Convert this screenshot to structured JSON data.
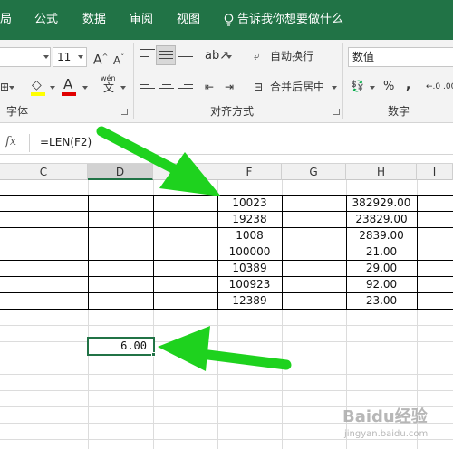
{
  "menu": {
    "tabs": [
      "局",
      "公式",
      "数据",
      "审阅",
      "视图"
    ],
    "tellme": "告诉我你想要做什么"
  },
  "ribbon": {
    "font_size": "11",
    "wen_glyph": "wén",
    "wen_char": "文",
    "wrap_text": "自动换行",
    "merge_center": "合并后居中",
    "number_format": "数值",
    "percent": "%",
    "comma": ",",
    "decimals": "←.0 .00",
    "groups": {
      "font": "字体",
      "alignment": "对齐方式",
      "number": "数字"
    }
  },
  "formula_bar": {
    "fx": "fx",
    "formula": "=LEN(F2)"
  },
  "columns": [
    "C",
    "D",
    "E",
    "F",
    "G",
    "H",
    "I"
  ],
  "selected_column": "D",
  "table": {
    "f_values": [
      "10023",
      "19238",
      "1008",
      "100000",
      "10389",
      "100923",
      "12389"
    ],
    "h_values": [
      "382929.00",
      "23829.00",
      "2839.00",
      "21.00",
      "29.00",
      "92.00",
      "23.00"
    ]
  },
  "active_cell": {
    "value": "6.00"
  },
  "watermark": {
    "brand": "Baidu经验",
    "url": "jingyan.baidu.com"
  },
  "colors": {
    "accent": "#217346",
    "arrow": "#1ed21e"
  }
}
